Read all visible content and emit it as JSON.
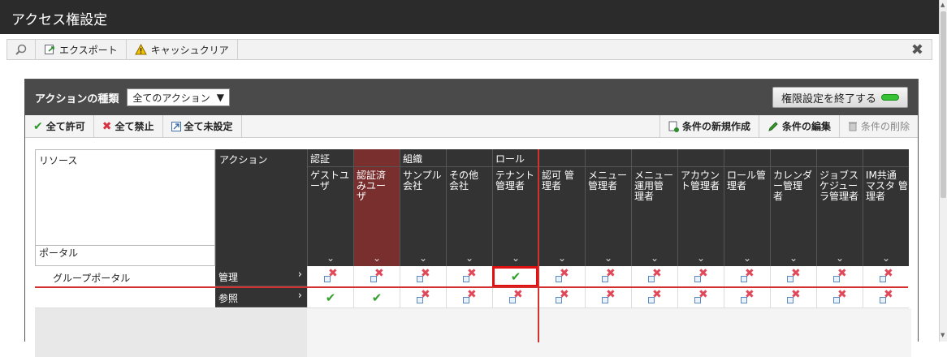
{
  "window": {
    "title": "アクセス権設定"
  },
  "toolbar": {
    "export": "エクスポート",
    "cache_clear": "キャッシュクリア",
    "close": "✖"
  },
  "panel": {
    "action_type_label": "アクションの種類",
    "action_select": "全てのアクション",
    "end_button": "権限設定を終了する"
  },
  "actionbar": {
    "allow_all": "全て許可",
    "deny_all": "全て禁止",
    "unset_all": "全て未設定",
    "new_condition": "条件の新規作成",
    "edit_condition": "条件の編集",
    "delete_condition": "条件の削除"
  },
  "grid": {
    "resource_label": "リソース",
    "portal_label": "ポータル",
    "action_label": "アクション",
    "groups": [
      "認証",
      "組織",
      "ロール"
    ],
    "columns": [
      {
        "name": "ゲストユ\nーザ",
        "group": "認証"
      },
      {
        "name": "認証済\nみユー\nザ",
        "group": "認証"
      },
      {
        "name": "サンプル\n会社",
        "group": "組織"
      },
      {
        "name": "その他\n会社",
        "group": "組織"
      },
      {
        "name": "テナント\n管理者",
        "group": "ロール"
      },
      {
        "name": "認可 管\n理者",
        "group": "ロール"
      },
      {
        "name": "メニュー\n管理者",
        "group": "ロール"
      },
      {
        "name": "メニュー\n運用管\n理者",
        "group": "ロール"
      },
      {
        "name": "アカウン\nト管理者",
        "group": "ロール"
      },
      {
        "name": "ロール管\n理者",
        "group": "ロール"
      },
      {
        "name": "カレンダ\nー管理\n者",
        "group": "ロール"
      },
      {
        "name": "ジョブス\nケジュー\nラ管理者",
        "group": "ロール"
      },
      {
        "name": "IM共通\nマスタ 管\n理者",
        "group": "ロール"
      }
    ],
    "rows": [
      {
        "resource": "グループポータル",
        "action": "管理",
        "cells": [
          "denied",
          "denied",
          "denied",
          "denied",
          "allowed",
          "denied",
          "denied",
          "denied",
          "denied",
          "denied",
          "denied",
          "denied",
          "denied"
        ]
      },
      {
        "resource": "",
        "action": "参照",
        "cells": [
          "allowed",
          "allowed",
          "denied",
          "denied",
          "denied",
          "denied",
          "denied",
          "denied",
          "denied",
          "denied",
          "denied",
          "denied",
          "denied"
        ]
      }
    ]
  },
  "colors": {
    "title_bg": "#2b2b2b",
    "selected_col": "#7a2f2f",
    "allowed": "#33a02c",
    "denied": "#e0495a",
    "highlight": "#e01010"
  }
}
